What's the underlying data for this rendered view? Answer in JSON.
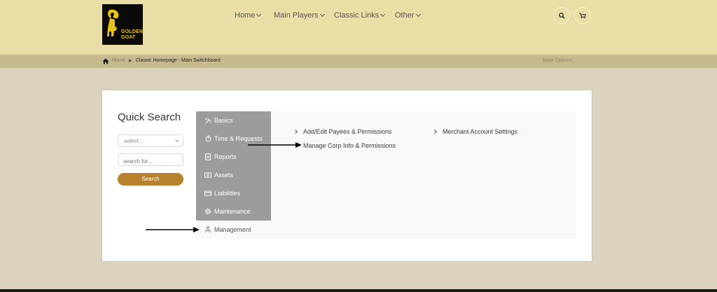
{
  "logo": {
    "line1": "GOLDEN",
    "line2": "GOAT",
    "icon": "goat-logo-icon"
  },
  "nav": {
    "items": [
      {
        "label": "Home"
      },
      {
        "label": "Main Players"
      },
      {
        "label": "Classic Links"
      },
      {
        "label": "Other"
      }
    ]
  },
  "header_icons": {
    "search": "search-icon",
    "cart": "cart-icon"
  },
  "breadcrumb": {
    "home": "Home",
    "current": "Classic Homepage - Main Switchboard",
    "more": "More Options..."
  },
  "quick_search": {
    "title": "Quick Search",
    "select_value": "select...",
    "search_placeholder": "search for...",
    "button_label": "Search"
  },
  "menu": {
    "items": [
      {
        "label": "Basics",
        "icon": "tools-icon"
      },
      {
        "label": "Time & Requests",
        "icon": "stopwatch-icon"
      },
      {
        "label": "Reports",
        "icon": "document-icon"
      },
      {
        "label": "Assets",
        "icon": "money-icon"
      },
      {
        "label": "Liabilities",
        "icon": "card-icon"
      },
      {
        "label": "Maintenance",
        "icon": "gear-icon"
      },
      {
        "label": "Management",
        "icon": "org-chart-icon"
      }
    ]
  },
  "submenu": {
    "links": [
      {
        "label": "Add/Edit Payees & Permissions"
      },
      {
        "label": "Manage Corp Info & Permissions"
      },
      {
        "label": "Merchant Account Settings"
      }
    ]
  },
  "colors": {
    "header_bg": "#e8dea6",
    "breadcrumb_bg": "#c6b98d",
    "page_bg": "#dbd3bd",
    "button_accent": "#b7812e",
    "menu_gray": "#9c9c9c"
  }
}
